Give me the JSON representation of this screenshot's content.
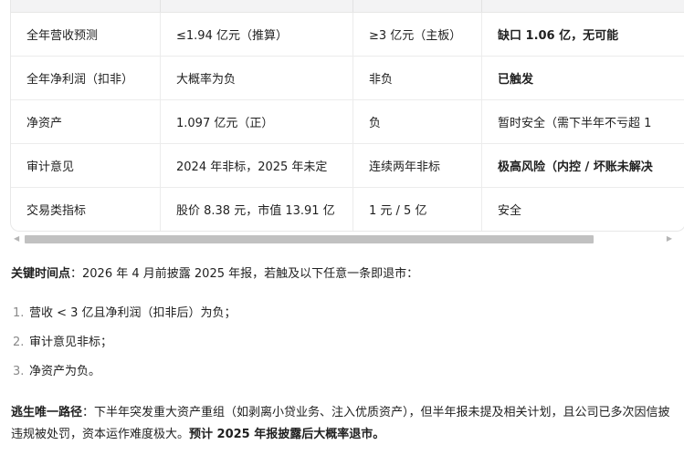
{
  "table": {
    "rows": [
      [
        "全年营收预测",
        "≤1.94 亿元（推算）",
        "≥3 亿元（主板）",
        "缺口 1.06 亿，无可能"
      ],
      [
        "全年净利润（扣非）",
        "大概率为负",
        "非负",
        "已触发"
      ],
      [
        "净资产",
        "1.097 亿元（正）",
        "负",
        "暂时安全（需下半年不亏超 1"
      ],
      [
        "审计意见",
        "2024 年非标，2025 年未定",
        "连续两年非标",
        "极高风险（内控 / 坏账未解决"
      ],
      [
        "交易类指标",
        "股价 8.38 元，市值 13.91 亿",
        "1 元 / 5 亿",
        "安全"
      ]
    ],
    "bold_last_col": [
      true,
      true,
      false,
      true,
      false
    ]
  },
  "key_time": {
    "label": "关键时间点",
    "text": "：2026 年 4 月前披露 2025 年报，若触及以下任意一条即退市："
  },
  "conditions": [
    {
      "num": "1.",
      "text": "营收 < 3 亿且净利润（扣非后）为负；"
    },
    {
      "num": "2.",
      "text": "审计意见非标；"
    },
    {
      "num": "3.",
      "text": "净资产为负。"
    }
  ],
  "escape": {
    "label": "逃生唯一路径",
    "text": "：下半年突发重大资产重组（如剥离小贷业务、注入优质资产），但半年报未提及相关计划，且公司已多次因信披违规被处罚，资本运作难度极大。",
    "conclusion": "预计 2025 年报披露后大概率退市。"
  },
  "scroll": {
    "left_arrow": "◀",
    "right_arrow": "▶"
  }
}
